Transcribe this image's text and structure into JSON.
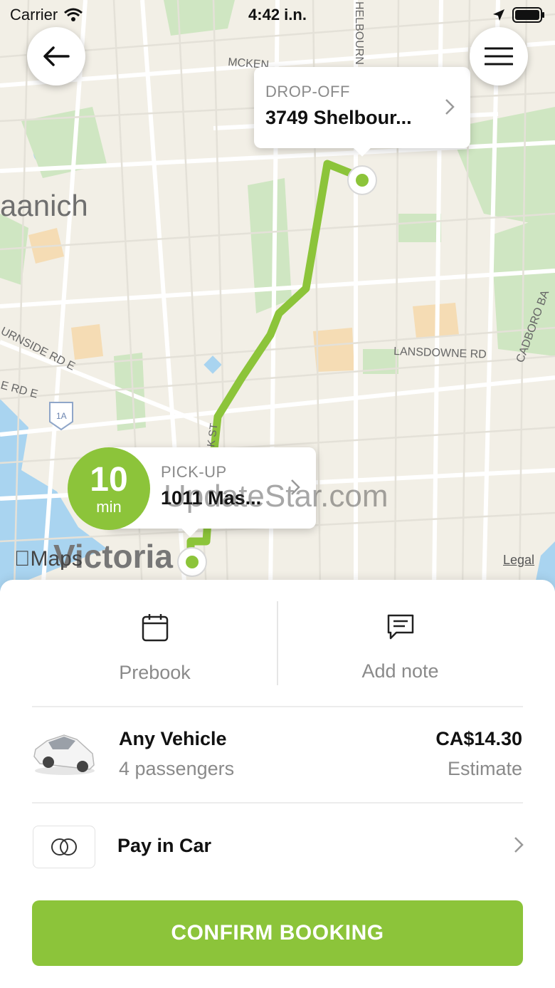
{
  "status_bar": {
    "carrier": "Carrier",
    "time": "4:42 i.n."
  },
  "map": {
    "labels": {
      "area_saanich": "aanich",
      "area_victoria": "Victoria",
      "road_mckenzie": "MCKEN",
      "road_shelbourne": "HELBOURN",
      "road_lansdowne": "LANSDOWNE RD",
      "road_cadboro": "CADBORO BA",
      "road_burnside": "URNSIDE RD E",
      "road_burnside2": "E RD E",
      "road_st": "K ST",
      "shield": "1A"
    },
    "dropoff": {
      "label": "DROP-OFF",
      "address": "3749 Shelbour..."
    },
    "pickup": {
      "label": "PICK-UP",
      "address": "1011 Mas..."
    },
    "eta": {
      "value": "10",
      "unit": "min"
    },
    "maps_brand": "Maps",
    "legal": "Legal",
    "watermark": "UpdateStar.com",
    "route_color": "#8cc43a"
  },
  "actions": {
    "prebook": "Prebook",
    "add_note": "Add note"
  },
  "vehicle": {
    "name": "Any Vehicle",
    "capacity": "4 passengers",
    "price": "CA$14.30",
    "price_note": "Estimate"
  },
  "payment": {
    "label": "Pay in Car"
  },
  "confirm": {
    "label": "CONFIRM BOOKING"
  },
  "colors": {
    "accent": "#8cc43a",
    "muted_text": "#8a8a8a"
  }
}
